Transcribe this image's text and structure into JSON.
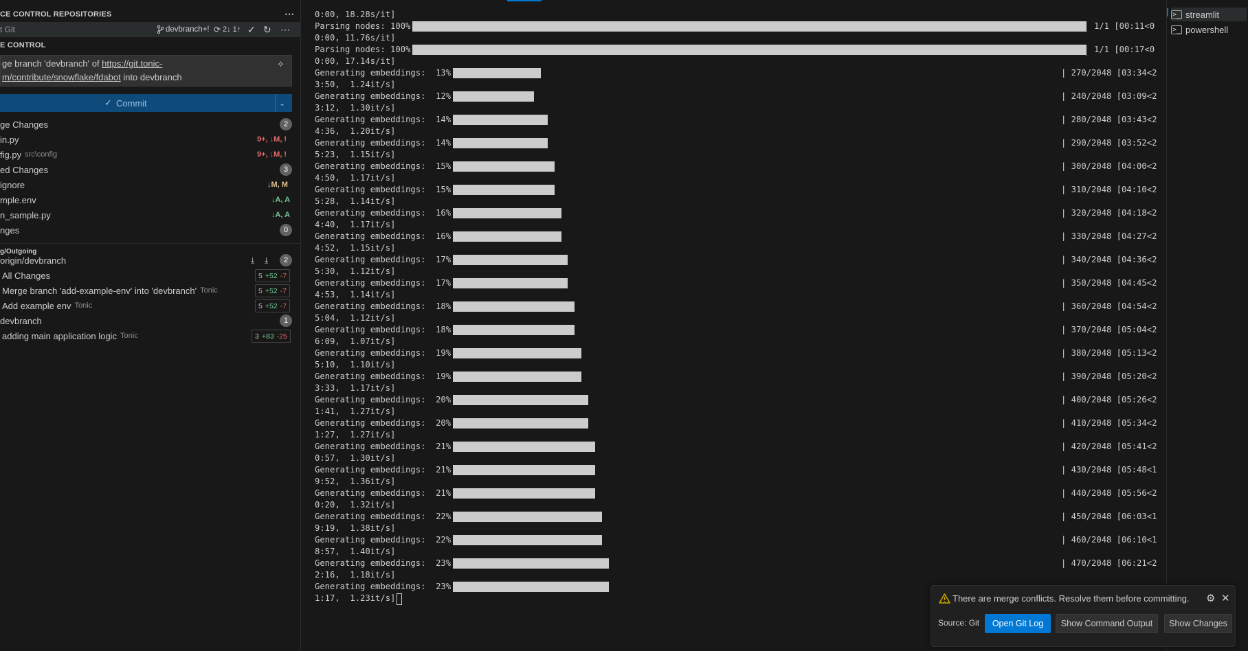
{
  "scm": {
    "repos_title": "CE CONTROL REPOSITORIES",
    "repo_name": "Git",
    "branch": "devbranch+!",
    "sync": "2↓ 1↑",
    "section_title": "E CONTROL",
    "commit_message_line1_pre": "ge branch 'devbranch' of ",
    "commit_message_link": "https://git.tonic-",
    "commit_message_line2_link": "m/contribute/snowflake/fdabot",
    "commit_message_line2_post": " into devbranch",
    "commit_button": "Commit",
    "merge_changes": {
      "label": "ge Changes",
      "count": "2"
    },
    "merge_files": [
      {
        "name": "in.py",
        "path": "",
        "status": "9+, ↓M, !"
      },
      {
        "name": "fig.py",
        "path": "src\\config",
        "status": "9+, ↓M, !"
      }
    ],
    "staged_changes": {
      "label": "ed Changes",
      "count": "3"
    },
    "staged_files": [
      {
        "name": "ignore",
        "status": "↓M, M"
      },
      {
        "name": "mple.env",
        "status": "↓A, A"
      },
      {
        "name": "n_sample.py",
        "status": "↓A, A"
      }
    ],
    "changes": {
      "label": "nges",
      "count": "0"
    },
    "incoming_outgoing": "g/Outgoing",
    "origin_branch": {
      "label": "origin/devbranch",
      "count": "2"
    },
    "incoming_items": [
      {
        "label": "All Changes",
        "author": "",
        "files": "5",
        "plus": "+52",
        "minus": "-7"
      },
      {
        "label": "Merge branch 'add-example-env' into 'devbranch'",
        "author": "Tonic",
        "files": "5",
        "plus": "+52",
        "minus": "-7"
      },
      {
        "label": "Add example env",
        "author": "Tonic",
        "files": "5",
        "plus": "+52",
        "minus": "-7"
      }
    ],
    "local_branch": {
      "label": "devbranch",
      "count": "1"
    },
    "outgoing_items": [
      {
        "label": "adding main application logic",
        "author": "Tonic",
        "files": "3",
        "plus": "+83",
        "minus": "-25"
      }
    ]
  },
  "terminal": {
    "lines": [
      "0:00, 18.28s/it]",
      "Parsing nodes: 100%|",
      "0:00, 11.76s/it]",
      "Parsing nodes: 100%|",
      "0:00, 17.14s/it]"
    ],
    "parse_rights": [
      "1/1 [00:11<0",
      "1/1 [00:17<0"
    ],
    "embeddings": [
      {
        "pct": "13%",
        "right": "270/2048 [03:34<2",
        "cont": "3:50,  1.24it/s]",
        "fill": 0.13
      },
      {
        "pct": "12%",
        "right": "240/2048 [03:09<2",
        "cont": "3:12,  1.30it/s]",
        "fill": 0.12
      },
      {
        "pct": "14%",
        "right": "280/2048 [03:43<2",
        "cont": "4:36,  1.20it/s]",
        "fill": 0.14
      },
      {
        "pct": "14%",
        "right": "290/2048 [03:52<2",
        "cont": "5:23,  1.15it/s]",
        "fill": 0.14
      },
      {
        "pct": "15%",
        "right": "300/2048 [04:00<2",
        "cont": "4:50,  1.17it/s]",
        "fill": 0.15
      },
      {
        "pct": "15%",
        "right": "310/2048 [04:10<2",
        "cont": "5:28,  1.14it/s]",
        "fill": 0.15
      },
      {
        "pct": "16%",
        "right": "320/2048 [04:18<2",
        "cont": "4:40,  1.17it/s]",
        "fill": 0.16
      },
      {
        "pct": "16%",
        "right": "330/2048 [04:27<2",
        "cont": "4:52,  1.15it/s]",
        "fill": 0.16
      },
      {
        "pct": "17%",
        "right": "340/2048 [04:36<2",
        "cont": "5:30,  1.12it/s]",
        "fill": 0.17
      },
      {
        "pct": "17%",
        "right": "350/2048 [04:45<2",
        "cont": "4:53,  1.14it/s]",
        "fill": 0.17
      },
      {
        "pct": "18%",
        "right": "360/2048 [04:54<2",
        "cont": "5:04,  1.12it/s]",
        "fill": 0.18
      },
      {
        "pct": "18%",
        "right": "370/2048 [05:04<2",
        "cont": "6:09,  1.07it/s]",
        "fill": 0.18
      },
      {
        "pct": "19%",
        "right": "380/2048 [05:13<2",
        "cont": "5:10,  1.10it/s]",
        "fill": 0.19
      },
      {
        "pct": "19%",
        "right": "390/2048 [05:20<2",
        "cont": "3:33,  1.17it/s]",
        "fill": 0.19
      },
      {
        "pct": "20%",
        "right": "400/2048 [05:26<2",
        "cont": "1:41,  1.27it/s]",
        "fill": 0.2
      },
      {
        "pct": "20%",
        "right": "410/2048 [05:34<2",
        "cont": "1:27,  1.27it/s]",
        "fill": 0.2
      },
      {
        "pct": "21%",
        "right": "420/2048 [05:41<2",
        "cont": "0:57,  1.30it/s]",
        "fill": 0.21
      },
      {
        "pct": "21%",
        "right": "430/2048 [05:48<1",
        "cont": "9:52,  1.36it/s]",
        "fill": 0.21
      },
      {
        "pct": "21%",
        "right": "440/2048 [05:56<2",
        "cont": "0:20,  1.32it/s]",
        "fill": 0.21
      },
      {
        "pct": "22%",
        "right": "450/2048 [06:03<1",
        "cont": "9:19,  1.38it/s]",
        "fill": 0.22
      },
      {
        "pct": "22%",
        "right": "460/2048 [06:10<1",
        "cont": "8:57,  1.40it/s]",
        "fill": 0.22
      },
      {
        "pct": "23%",
        "right": "470/2048 [06:21<2",
        "cont": "2:16,  1.18it/s]",
        "fill": 0.23
      },
      {
        "pct": "23%",
        "right": "",
        "cont": "1:17,  1.23it/s]",
        "fill": 0.23
      }
    ],
    "embed_label": "Generating embeddings:  "
  },
  "termlist": {
    "items": [
      "streamlit",
      "powershell"
    ]
  },
  "notification": {
    "message": "There are merge conflicts. Resolve them before committing.",
    "source": "Source: Git",
    "buttons": [
      "Open Git Log",
      "Show Command Output",
      "Show Changes"
    ]
  },
  "colors": {
    "accent": "#0078d4",
    "warning": "#cca700",
    "modified": "#e2c08d",
    "added": "#73c991",
    "conflict": "#e06c6c"
  }
}
